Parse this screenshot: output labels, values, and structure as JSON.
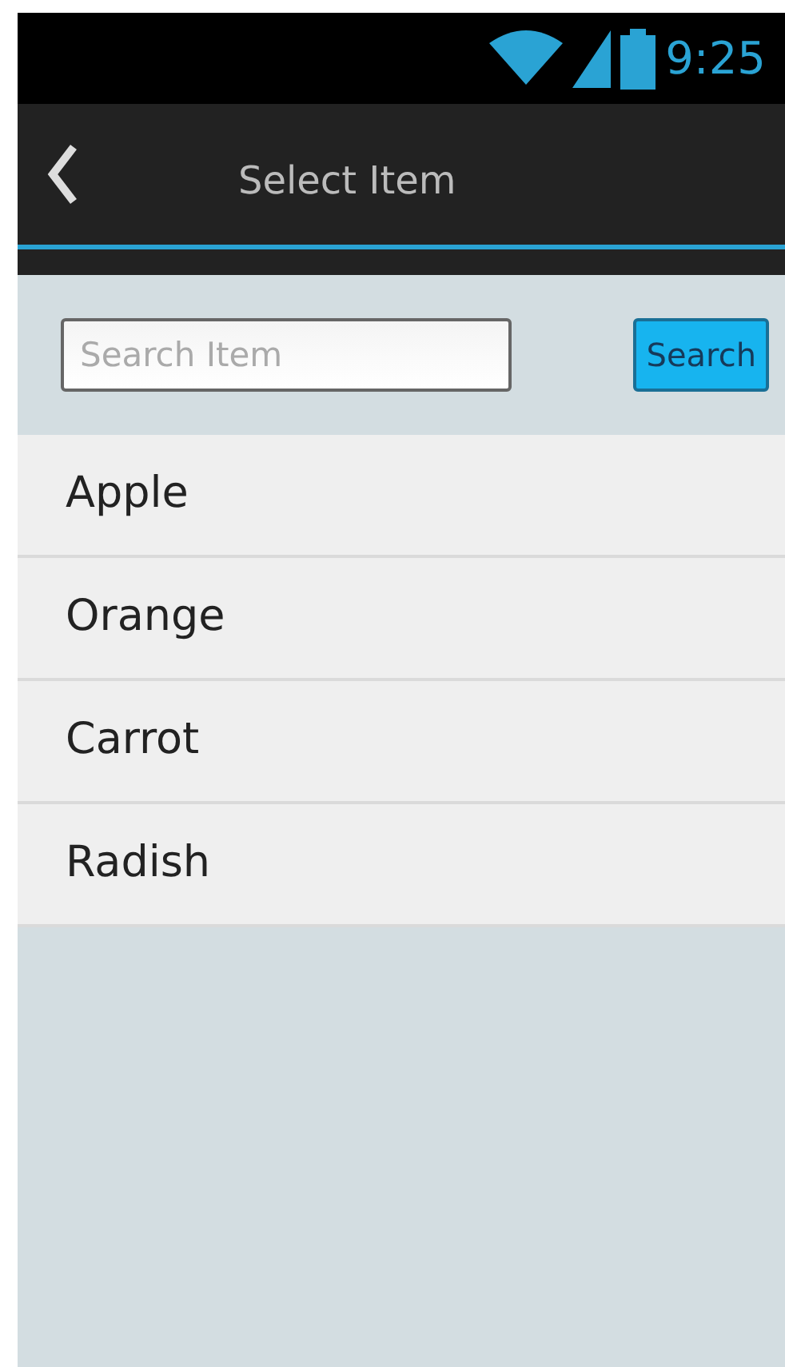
{
  "status_bar": {
    "time": "9:25"
  },
  "header": {
    "title": "Select Item"
  },
  "search": {
    "placeholder": "Search Item",
    "button": "Search"
  },
  "items": [
    {
      "label": "Apple"
    },
    {
      "label": "Orange"
    },
    {
      "label": "Carrot"
    },
    {
      "label": "Radish"
    }
  ]
}
